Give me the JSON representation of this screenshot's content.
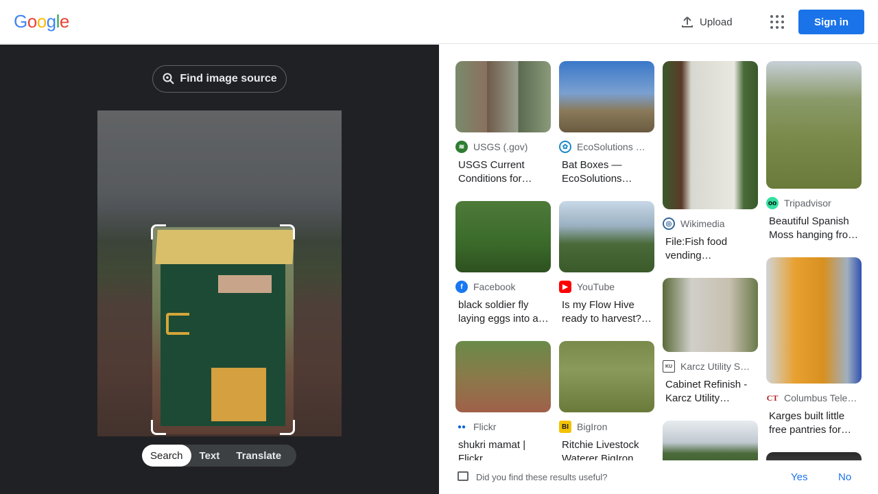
{
  "header": {
    "logo_letters": [
      "G",
      "o",
      "o",
      "g",
      "l",
      "e"
    ],
    "upload_label": "Upload",
    "signin_label": "Sign in"
  },
  "left": {
    "find_source_label": "Find image source",
    "modes": [
      {
        "label": "Search",
        "active": true
      },
      {
        "label": "Text",
        "active": false
      },
      {
        "label": "Translate",
        "active": false
      }
    ]
  },
  "results": [
    {
      "source": "USGS (.gov)",
      "title": "USGS Current Conditions for…"
    },
    {
      "source": "Facebook",
      "title": "black soldier fly laying eggs into a…"
    },
    {
      "source": "Flickr",
      "title": "shukri mamat | Flickr"
    },
    {
      "source": "EcoSolutions …",
      "title": "Bat Boxes — EcoSolutions…"
    },
    {
      "source": "YouTube",
      "title": "Is my Flow Hive ready to harvest?…"
    },
    {
      "source": "BigIron",
      "title": "Ritchie Livestock Waterer BigIron…"
    },
    {
      "source": "Wikimedia",
      "title": "File:Fish food vending…"
    },
    {
      "source": "Karcz Utility S…",
      "title": "Cabinet Refinish - Karcz Utility…"
    },
    {
      "source": "Tripadvisor",
      "title": "Beautiful Spanish Moss hanging fro…"
    },
    {
      "source": "Columbus Tele…",
      "title": "Karges built little free pantries for…"
    }
  ],
  "feedback": {
    "question": "Did you find these results useful?",
    "yes_label": "Yes",
    "no_label": "No"
  },
  "colors": {
    "accent": "#1a73e8",
    "dark_panel": "#202124"
  }
}
